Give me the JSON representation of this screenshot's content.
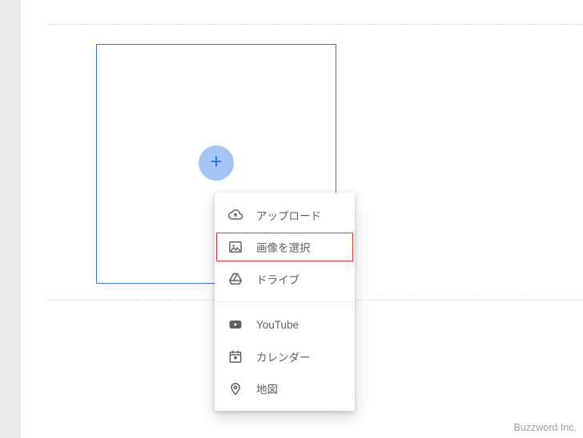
{
  "add_button": {
    "title": "Add"
  },
  "menu": {
    "items": {
      "upload": {
        "label": "アップロード"
      },
      "select": {
        "label": "画像を選択"
      },
      "drive": {
        "label": "ドライブ"
      },
      "youtube": {
        "label": "YouTube"
      },
      "calendar": {
        "label": "カレンダー"
      },
      "map": {
        "label": "地図"
      }
    }
  },
  "footer": {
    "text": "Buzzword Inc."
  }
}
